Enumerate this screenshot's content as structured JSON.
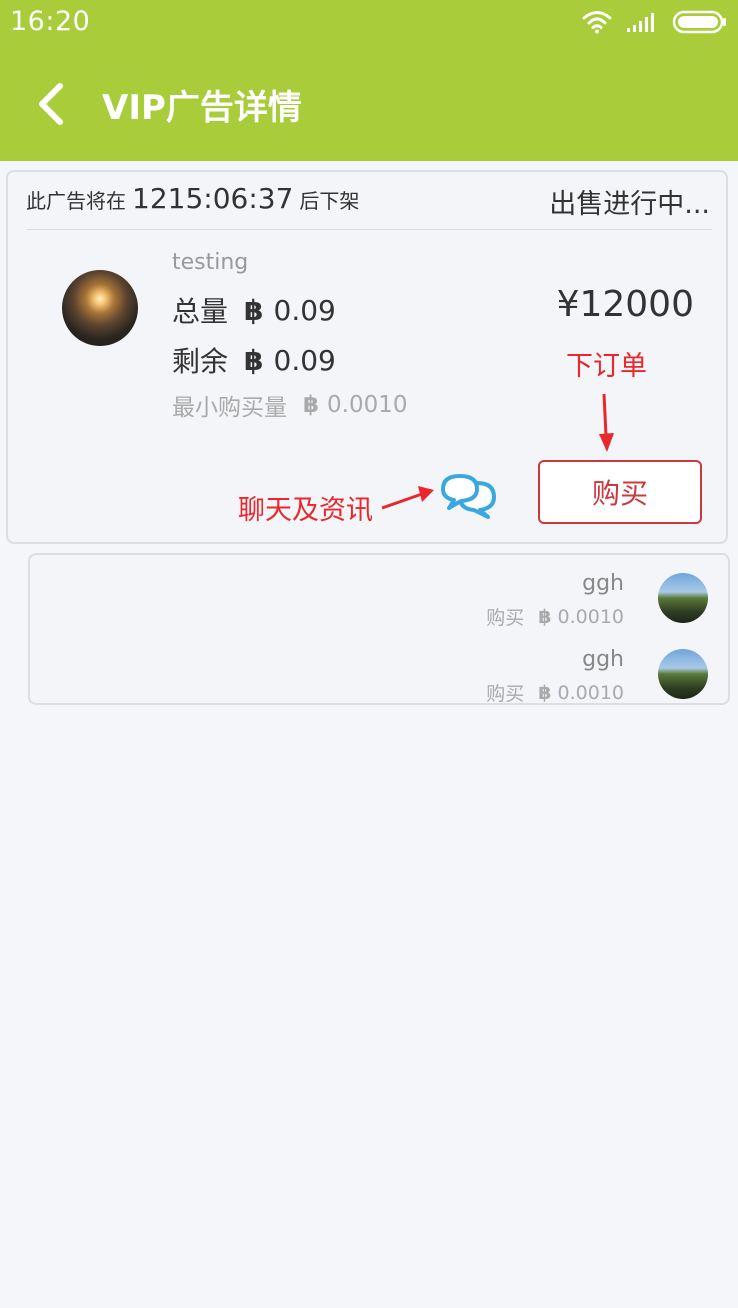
{
  "status_bar": {
    "time": "16:20"
  },
  "app_bar": {
    "title": "VIP广告详情"
  },
  "ad": {
    "countdown_prefix": "此广告将在",
    "countdown_time": "1215:06:37",
    "countdown_suffix": "后下架",
    "status": "出售进行中...",
    "seller_name": "testing",
    "total_label": "总量",
    "total_value": "0.09",
    "remaining_label": "剩余",
    "remaining_value": "0.09",
    "min_label": "最小购买量",
    "min_value": "0.0010",
    "price": "¥12000",
    "buy_label": "购买",
    "btc_symbol": "฿"
  },
  "annotations": {
    "order_note": "下订单",
    "chat_note": "聊天及资讯"
  },
  "orders": [
    {
      "name": "ggh",
      "action": "购买",
      "amount": "0.0010"
    },
    {
      "name": "ggh",
      "action": "购买",
      "amount": "0.0010"
    }
  ],
  "colors": {
    "header": "#a9cc3a",
    "buy_accent": "#c9393d",
    "annotation": "#e8282c",
    "chat_icon": "#3aa8e0"
  },
  "icons": {
    "back": "chevron-left-icon",
    "chat": "chat-bubbles-icon",
    "wifi": "wifi-icon",
    "signal": "signal-icon",
    "battery": "battery-icon"
  }
}
